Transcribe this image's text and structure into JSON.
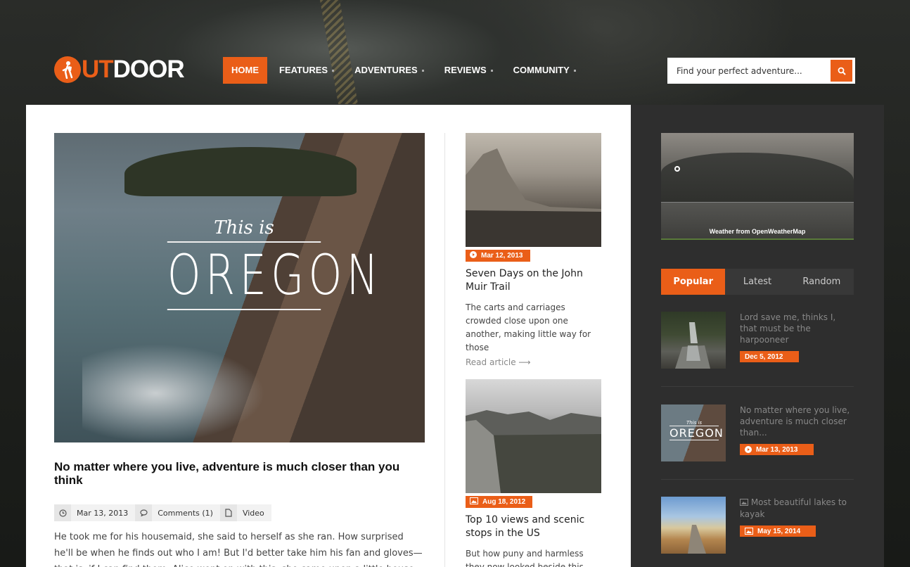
{
  "header": {
    "logo_o": "O",
    "logo_ut": "UT",
    "logo_door": "DOOR",
    "nav": [
      {
        "label": "HOME",
        "active": true
      },
      {
        "label": "FEATURES",
        "active": false
      },
      {
        "label": "ADVENTURES",
        "active": false
      },
      {
        "label": "REVIEWS",
        "active": false
      },
      {
        "label": "COMMUNITY",
        "active": false
      }
    ],
    "search": {
      "placeholder": "Find your perfect adventure...",
      "icon": "search-icon"
    }
  },
  "colors": {
    "accent": "#ea5e18"
  },
  "featured": {
    "image_text_small": "This is",
    "image_text_big": "OREGON",
    "title": "No matter where you live, adventure is much closer than you think",
    "meta": {
      "date": "Mar 13, 2013",
      "comments": "Comments (1)",
      "format": "Video"
    },
    "excerpt": "He took me for his housemaid, she said to herself as she ran. How surprised he'll be when he finds out who I am! But I'd better take him his fan and gloves—that is, if I can find them, Alice went on with this, she came upon a little house, on the door of which"
  },
  "cards": [
    {
      "badge_icon": "play-icon",
      "date": "Mar 12, 2013",
      "title": "Seven Days on the John Muir Trail",
      "text": "The carts and carriages crowded close upon one another, making little way for those",
      "read_more": "Read article ⟶"
    },
    {
      "badge_icon": "image-icon",
      "date": "Aug 18, 2012",
      "title": "Top 10 views and scenic stops in the US",
      "text": "But how puny and harmless they now looked beside this huge and"
    }
  ],
  "sidebar": {
    "weather_credit": "Weather from OpenWeatherMap",
    "tabs": [
      {
        "label": "Popular",
        "active": true
      },
      {
        "label": "Latest",
        "active": false
      },
      {
        "label": "Random",
        "active": false
      }
    ],
    "posts": [
      {
        "title": "Lord save me, thinks I, that must be the harpooneer",
        "date": "Dec 5, 2012",
        "icon": ""
      },
      {
        "title": "No matter where you live, adventure is much closer than...",
        "date": "Mar 13, 2013",
        "icon": "play-icon",
        "thumb_small": "This is",
        "thumb_big": "OREGON"
      },
      {
        "title": "Most beautiful lakes to kayak",
        "date": "May 15, 2014",
        "icon": "image-icon",
        "title_icon": "image-icon"
      }
    ]
  }
}
